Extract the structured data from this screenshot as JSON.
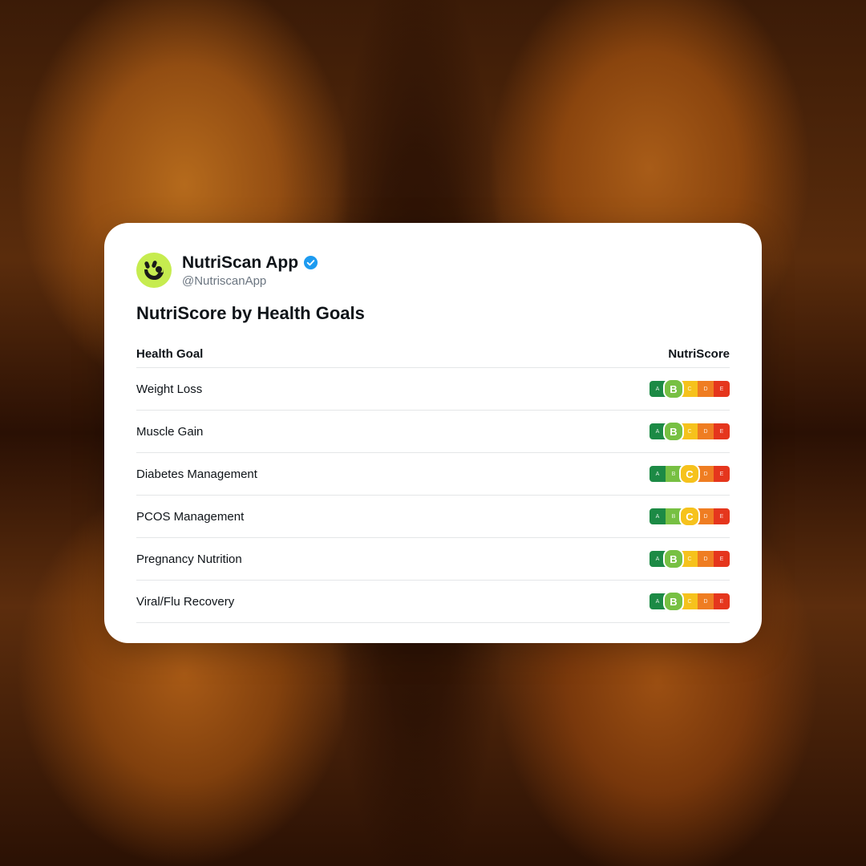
{
  "profile": {
    "name": "NutriScan App",
    "handle": "@NutriscanApp",
    "avatar_icon": "nutriscan-logo-icon",
    "verified_icon": "verified-badge-icon"
  },
  "title": "NutriScore by Health Goals",
  "table": {
    "headers": {
      "goal": "Health Goal",
      "score": "NutriScore"
    },
    "grades": [
      "A",
      "B",
      "C",
      "D",
      "E"
    ],
    "grade_colors": {
      "A": "#1c8a45",
      "B": "#77c043",
      "C": "#f6c21c",
      "D": "#ef7d22",
      "E": "#e5361d"
    },
    "rows": [
      {
        "goal": "Weight Loss",
        "score": "B"
      },
      {
        "goal": "Muscle Gain",
        "score": "B"
      },
      {
        "goal": "Diabetes Management",
        "score": "C"
      },
      {
        "goal": "PCOS Management",
        "score": "C"
      },
      {
        "goal": "Pregnancy Nutrition",
        "score": "B"
      },
      {
        "goal": "Viral/Flu Recovery",
        "score": "B"
      }
    ]
  },
  "colors": {
    "brand_lime": "#c6ec4f",
    "verified_blue": "#1d9bf0"
  }
}
